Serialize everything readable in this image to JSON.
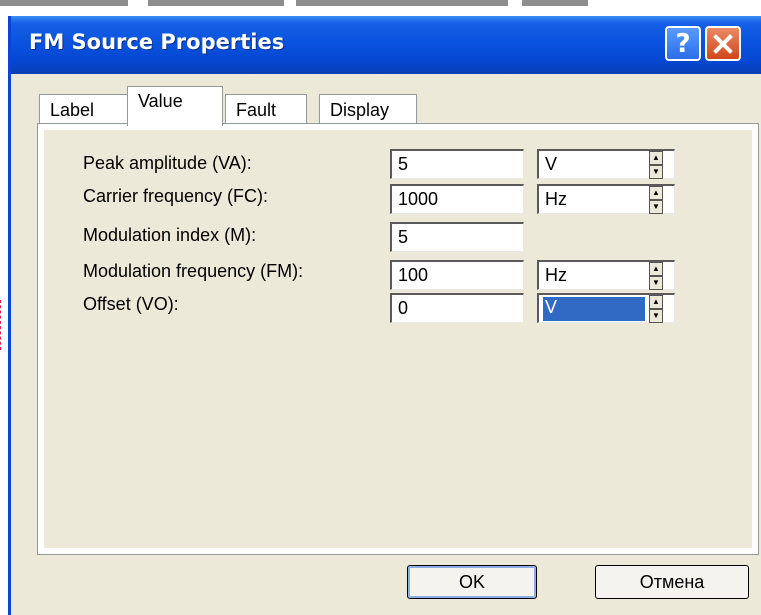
{
  "window": {
    "title": "FM Source Properties"
  },
  "tabs": [
    {
      "label": "Label"
    },
    {
      "label": "Value"
    },
    {
      "label": "Fault"
    },
    {
      "label": "Display"
    }
  ],
  "active_tab": "Value",
  "fields": [
    {
      "label": "Peak amplitude (VA):",
      "value": "5",
      "unit": "V"
    },
    {
      "label": "Carrier frequency (FC):",
      "value": "1000",
      "unit": "Hz"
    },
    {
      "label": "Modulation index (M):",
      "value": "5",
      "unit": ""
    },
    {
      "label": "Modulation frequency (FM):",
      "value": "100",
      "unit": "Hz"
    },
    {
      "label": "Offset (VO):",
      "value": "0",
      "unit": "V"
    }
  ],
  "buttons": {
    "ok": "OK",
    "cancel": "Отмена"
  },
  "colors": {
    "titlebar": "#0a53df",
    "dialog_bg": "#ece9d8",
    "selection": "#316ac5",
    "close_button": "#d0451c"
  },
  "icons": {
    "help": "question-mark-icon",
    "close": "close-x-icon",
    "spinner": "spin-arrows-icon"
  }
}
